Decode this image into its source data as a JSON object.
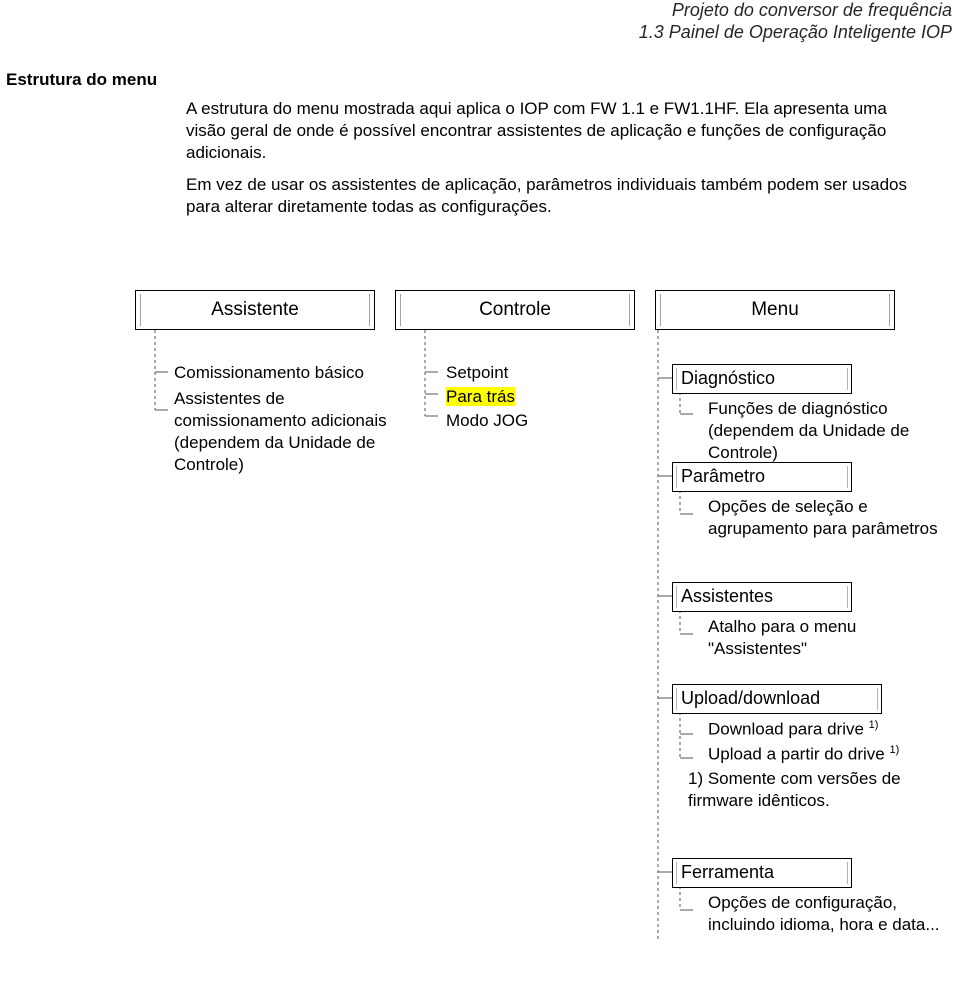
{
  "header": {
    "line1": "Projeto do conversor de frequência",
    "line2": "1.3 Painel de Operação Inteligente IOP"
  },
  "section_title": "Estrutura do menu",
  "paragraphs": {
    "p1": "A estrutura do menu mostrada aqui aplica o IOP com FW 1.1 e FW1.1HF. Ela apresenta uma visão geral de onde é possível encontrar assistentes de aplicação e funções de configuração adicionais.",
    "p2": "Em vez de usar os assistentes de aplicação, parâmetros individuais também podem ser usados para alterar diretamente todas as configurações."
  },
  "top": {
    "assistente": "Assistente",
    "controle": "Controle",
    "menu": "Menu"
  },
  "col1": {
    "item1": "Comissionamento básico",
    "item2": "Assistentes de comissionamento adicionais (dependem da Unidade de Controle)"
  },
  "col2": {
    "setpoint": "Setpoint",
    "para_tras": "Para trás",
    "modo_jog": "Modo JOG"
  },
  "col3": {
    "diagnostico": "Diagnóstico",
    "diag_sub": "Funções de diagnóstico (dependem da Unidade de Controle)",
    "parametro": "Parâmetro",
    "param_sub": "Opções de seleção e agrupamento para parâmetros",
    "assistentes": "Assistentes",
    "assist_sub": "Atalho para o menu \"Assistentes\"",
    "upload": "Upload/download",
    "upload_sub1": "Download para drive",
    "upload_sub2": "Upload a partir do drive",
    "upload_note": "1) Somente com versões de firmware idênticos.",
    "sup1": "1)",
    "ferramenta": "Ferramenta",
    "ferr_sub": "Opções de configuração, incluindo idioma, hora e data..."
  }
}
